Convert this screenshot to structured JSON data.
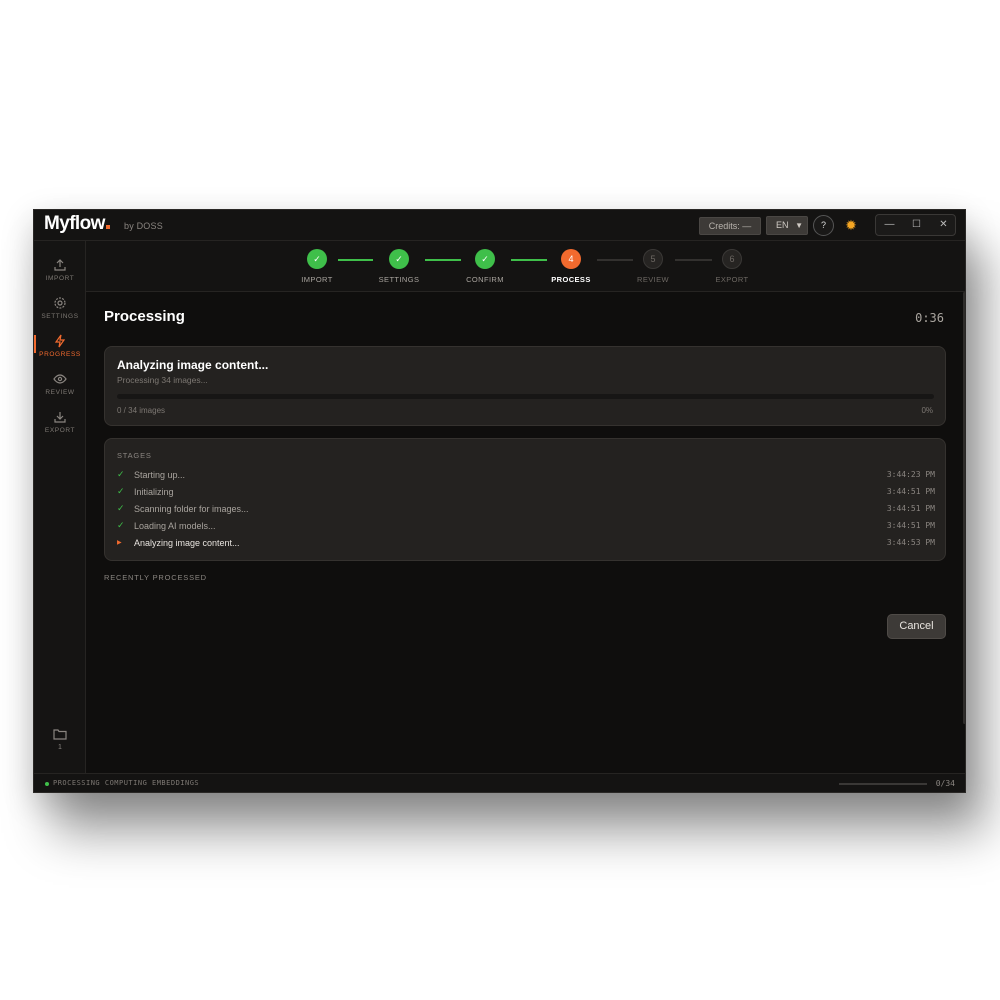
{
  "app": {
    "name": "Myflow",
    "subtitle": "by DOSS"
  },
  "titlebar": {
    "credits_label": "Credits: —",
    "language": "EN",
    "help_label": "?",
    "window_controls": {
      "minimize": "—",
      "maximize": "☐",
      "close": "✕"
    }
  },
  "sidebar": {
    "items": [
      {
        "label": "IMPORT",
        "icon": "upload-icon",
        "active": false
      },
      {
        "label": "SETTINGS",
        "icon": "gear-icon",
        "active": false
      },
      {
        "label": "PROGRESS",
        "icon": "lightning-icon",
        "active": true
      },
      {
        "label": "REVIEW",
        "icon": "eye-icon",
        "active": false
      },
      {
        "label": "EXPORT",
        "icon": "download-icon",
        "active": false
      }
    ],
    "folder_count": "1"
  },
  "stepper": {
    "steps": [
      {
        "num": "✓",
        "label": "IMPORT",
        "state": "done"
      },
      {
        "num": "✓",
        "label": "SETTINGS",
        "state": "done"
      },
      {
        "num": "✓",
        "label": "CONFIRM",
        "state": "done"
      },
      {
        "num": "4",
        "label": "PROCESS",
        "state": "current"
      },
      {
        "num": "5",
        "label": "REVIEW",
        "state": "pending"
      },
      {
        "num": "6",
        "label": "EXPORT",
        "state": "pending"
      }
    ]
  },
  "main": {
    "title": "Processing",
    "timer": "0:36",
    "analyze": {
      "title": "Analyzing image content...",
      "subtitle": "Processing 34 images...",
      "count": "0 / 34 images",
      "percent": "0%",
      "progress_fraction": 0
    },
    "stages": {
      "heading": "STAGES",
      "items": [
        {
          "text": "Starting up...",
          "time": "3:44:23 PM",
          "state": "done"
        },
        {
          "text": "Initializing",
          "time": "3:44:51 PM",
          "state": "done"
        },
        {
          "text": "Scanning folder for images...",
          "time": "3:44:51 PM",
          "state": "done"
        },
        {
          "text": "Loading AI models...",
          "time": "3:44:51 PM",
          "state": "done"
        },
        {
          "text": "Analyzing image content...",
          "time": "3:44:53 PM",
          "state": "current"
        }
      ]
    },
    "recent_label": "RECENTLY PROCESSED",
    "cancel_label": "Cancel"
  },
  "statusbar": {
    "text": "PROCESSING  COMPUTING EMBEDDINGS",
    "count": "0/34",
    "progress_fraction": 0
  },
  "colors": {
    "accent": "#f26a2e",
    "success": "#3fbf4a",
    "background": "#0f0e0d",
    "card": "#242220"
  }
}
